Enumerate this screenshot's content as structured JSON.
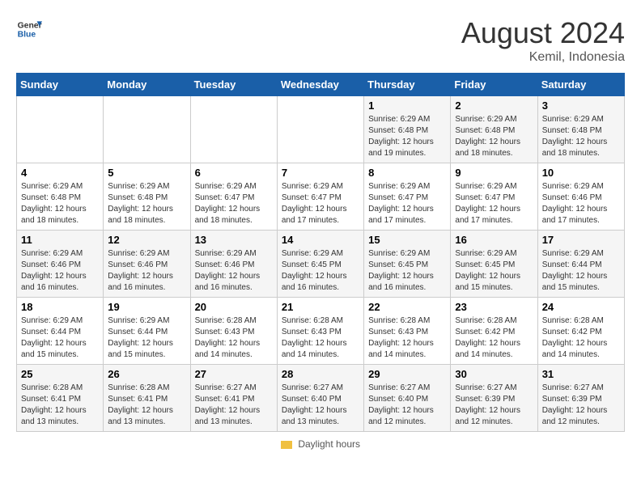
{
  "brand": {
    "name_general": "General",
    "name_blue": "Blue",
    "logo_color": "#1a5fa8"
  },
  "header": {
    "month_year": "August 2024",
    "location": "Kemil, Indonesia"
  },
  "days_of_week": [
    "Sunday",
    "Monday",
    "Tuesday",
    "Wednesday",
    "Thursday",
    "Friday",
    "Saturday"
  ],
  "footer_label": "Daylight hours",
  "weeks": [
    [
      {
        "day": "",
        "info": ""
      },
      {
        "day": "",
        "info": ""
      },
      {
        "day": "",
        "info": ""
      },
      {
        "day": "",
        "info": ""
      },
      {
        "day": "1",
        "info": "Sunrise: 6:29 AM\nSunset: 6:48 PM\nDaylight: 12 hours\nand 19 minutes."
      },
      {
        "day": "2",
        "info": "Sunrise: 6:29 AM\nSunset: 6:48 PM\nDaylight: 12 hours\nand 18 minutes."
      },
      {
        "day": "3",
        "info": "Sunrise: 6:29 AM\nSunset: 6:48 PM\nDaylight: 12 hours\nand 18 minutes."
      }
    ],
    [
      {
        "day": "4",
        "info": "Sunrise: 6:29 AM\nSunset: 6:48 PM\nDaylight: 12 hours\nand 18 minutes."
      },
      {
        "day": "5",
        "info": "Sunrise: 6:29 AM\nSunset: 6:48 PM\nDaylight: 12 hours\nand 18 minutes."
      },
      {
        "day": "6",
        "info": "Sunrise: 6:29 AM\nSunset: 6:47 PM\nDaylight: 12 hours\nand 18 minutes."
      },
      {
        "day": "7",
        "info": "Sunrise: 6:29 AM\nSunset: 6:47 PM\nDaylight: 12 hours\nand 17 minutes."
      },
      {
        "day": "8",
        "info": "Sunrise: 6:29 AM\nSunset: 6:47 PM\nDaylight: 12 hours\nand 17 minutes."
      },
      {
        "day": "9",
        "info": "Sunrise: 6:29 AM\nSunset: 6:47 PM\nDaylight: 12 hours\nand 17 minutes."
      },
      {
        "day": "10",
        "info": "Sunrise: 6:29 AM\nSunset: 6:46 PM\nDaylight: 12 hours\nand 17 minutes."
      }
    ],
    [
      {
        "day": "11",
        "info": "Sunrise: 6:29 AM\nSunset: 6:46 PM\nDaylight: 12 hours\nand 16 minutes."
      },
      {
        "day": "12",
        "info": "Sunrise: 6:29 AM\nSunset: 6:46 PM\nDaylight: 12 hours\nand 16 minutes."
      },
      {
        "day": "13",
        "info": "Sunrise: 6:29 AM\nSunset: 6:46 PM\nDaylight: 12 hours\nand 16 minutes."
      },
      {
        "day": "14",
        "info": "Sunrise: 6:29 AM\nSunset: 6:45 PM\nDaylight: 12 hours\nand 16 minutes."
      },
      {
        "day": "15",
        "info": "Sunrise: 6:29 AM\nSunset: 6:45 PM\nDaylight: 12 hours\nand 16 minutes."
      },
      {
        "day": "16",
        "info": "Sunrise: 6:29 AM\nSunset: 6:45 PM\nDaylight: 12 hours\nand 15 minutes."
      },
      {
        "day": "17",
        "info": "Sunrise: 6:29 AM\nSunset: 6:44 PM\nDaylight: 12 hours\nand 15 minutes."
      }
    ],
    [
      {
        "day": "18",
        "info": "Sunrise: 6:29 AM\nSunset: 6:44 PM\nDaylight: 12 hours\nand 15 minutes."
      },
      {
        "day": "19",
        "info": "Sunrise: 6:29 AM\nSunset: 6:44 PM\nDaylight: 12 hours\nand 15 minutes."
      },
      {
        "day": "20",
        "info": "Sunrise: 6:28 AM\nSunset: 6:43 PM\nDaylight: 12 hours\nand 14 minutes."
      },
      {
        "day": "21",
        "info": "Sunrise: 6:28 AM\nSunset: 6:43 PM\nDaylight: 12 hours\nand 14 minutes."
      },
      {
        "day": "22",
        "info": "Sunrise: 6:28 AM\nSunset: 6:43 PM\nDaylight: 12 hours\nand 14 minutes."
      },
      {
        "day": "23",
        "info": "Sunrise: 6:28 AM\nSunset: 6:42 PM\nDaylight: 12 hours\nand 14 minutes."
      },
      {
        "day": "24",
        "info": "Sunrise: 6:28 AM\nSunset: 6:42 PM\nDaylight: 12 hours\nand 14 minutes."
      }
    ],
    [
      {
        "day": "25",
        "info": "Sunrise: 6:28 AM\nSunset: 6:41 PM\nDaylight: 12 hours\nand 13 minutes."
      },
      {
        "day": "26",
        "info": "Sunrise: 6:28 AM\nSunset: 6:41 PM\nDaylight: 12 hours\nand 13 minutes."
      },
      {
        "day": "27",
        "info": "Sunrise: 6:27 AM\nSunset: 6:41 PM\nDaylight: 12 hours\nand 13 minutes."
      },
      {
        "day": "28",
        "info": "Sunrise: 6:27 AM\nSunset: 6:40 PM\nDaylight: 12 hours\nand 13 minutes."
      },
      {
        "day": "29",
        "info": "Sunrise: 6:27 AM\nSunset: 6:40 PM\nDaylight: 12 hours\nand 12 minutes."
      },
      {
        "day": "30",
        "info": "Sunrise: 6:27 AM\nSunset: 6:39 PM\nDaylight: 12 hours\nand 12 minutes."
      },
      {
        "day": "31",
        "info": "Sunrise: 6:27 AM\nSunset: 6:39 PM\nDaylight: 12 hours\nand 12 minutes."
      }
    ]
  ]
}
